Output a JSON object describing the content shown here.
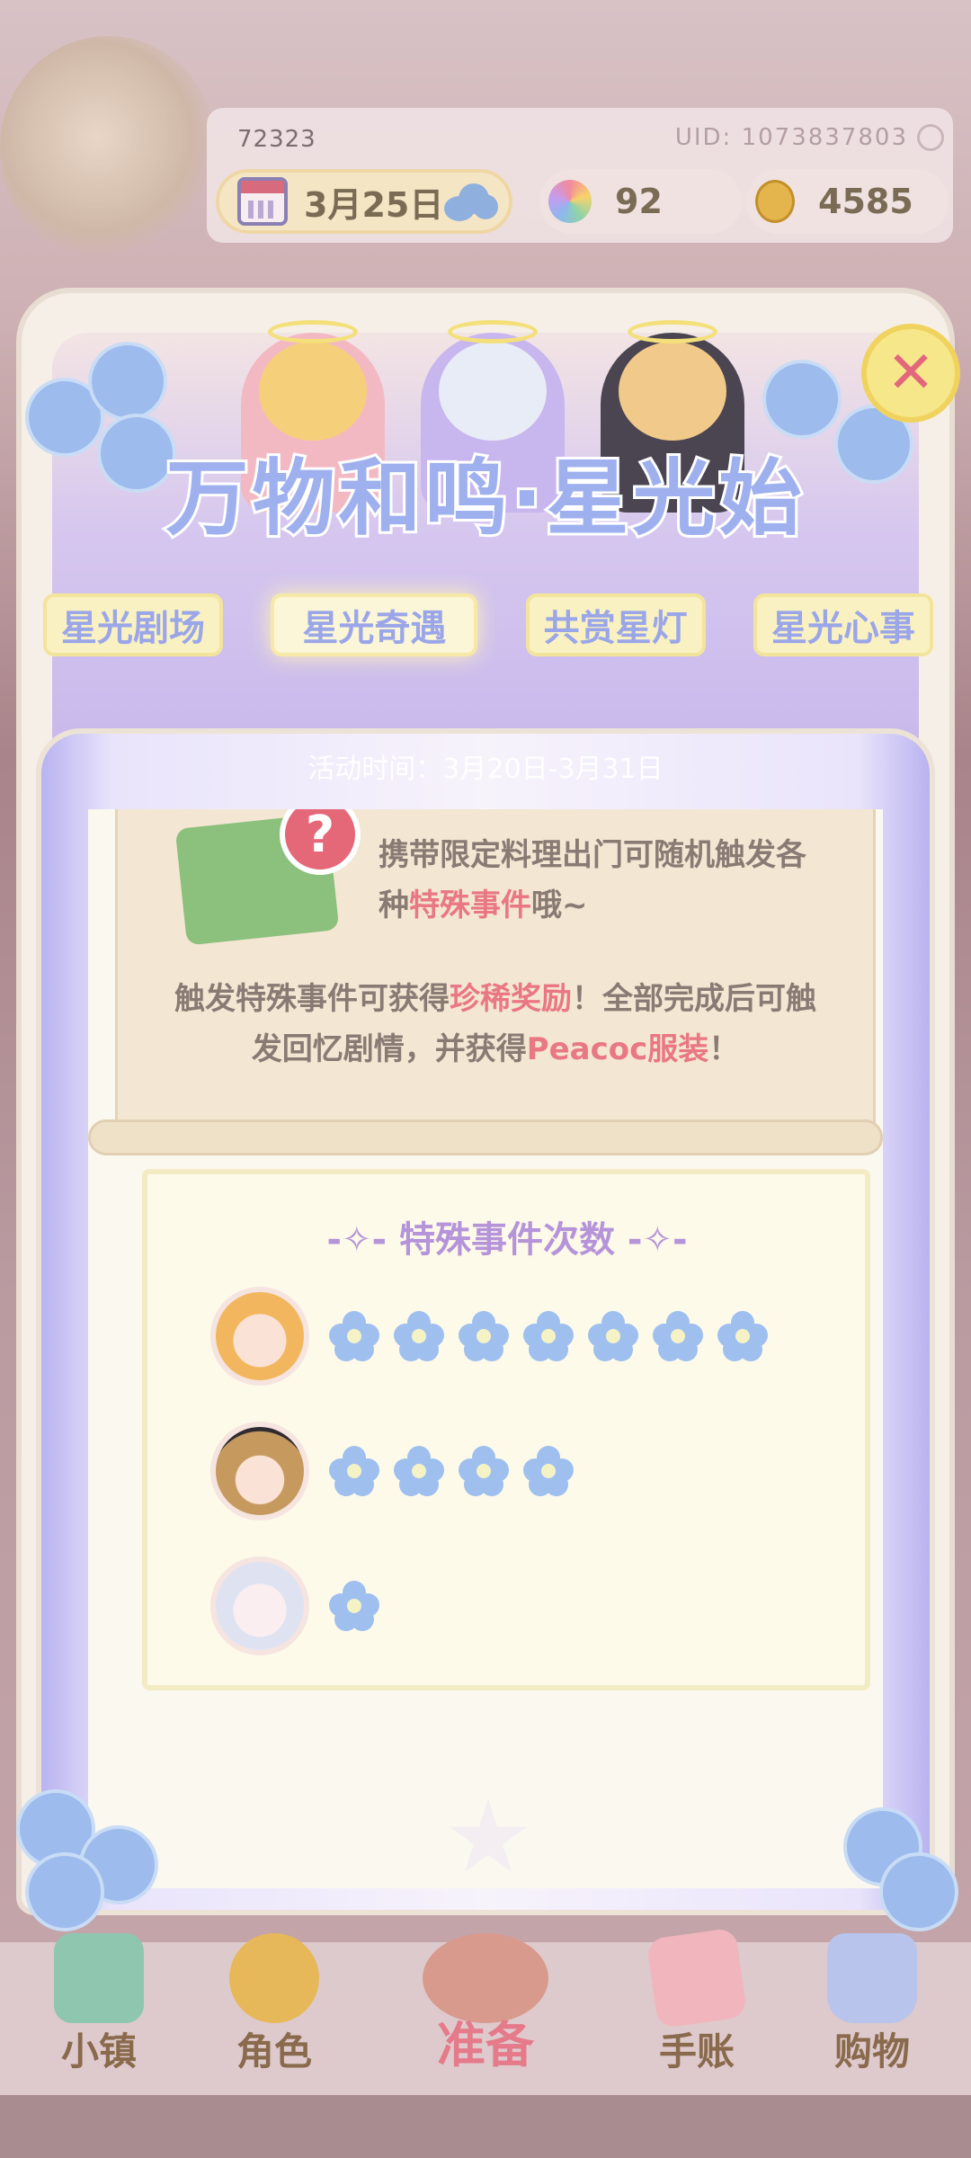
{
  "hud": {
    "player_id": "72323",
    "uid": "UID: 1073837803",
    "date": "3月25日",
    "gems": "92",
    "coins": "4585",
    "icons": {
      "calendar": "calendar-icon",
      "weather": "cloud-icon",
      "gem": "rainbow-gem-icon",
      "coin": "gold-coin-icon"
    }
  },
  "event": {
    "title": "万物和鸣·星光始",
    "tabs": [
      "星光剧场",
      "星光奇遇",
      "共赏星灯",
      "星光心事"
    ],
    "active_tab": 1,
    "time": "活动时间：3月20日-3月31日"
  },
  "info": {
    "p1_prefix": "携带限定料理出门可随机触发各种",
    "p1_highlight": "特殊事件",
    "p1_suffix": "哦~",
    "p2_prefix": "触发特殊事件可获得",
    "p2_highlight1": "珍稀奖励",
    "p2_middle": "！全部完成后可触发回忆剧情，并获得",
    "p2_highlight2": "Peacoc服装",
    "p2_suffix": "！"
  },
  "counts": {
    "title": "特殊事件次数",
    "rows": [
      {
        "character": "blonde-girl-avatar",
        "flowers": 7
      },
      {
        "character": "brown-hair-boy-avatar",
        "flowers": 4
      },
      {
        "character": "silver-hair-child-avatar",
        "flowers": 1
      }
    ]
  },
  "nav": [
    "小镇",
    "角色",
    "准备",
    "手账",
    "购物"
  ],
  "colors": {
    "accent_pink": "#e97784",
    "tab_text": "#9aa6e8",
    "title": "#9fb0ee",
    "count_title": "#b594d9"
  }
}
